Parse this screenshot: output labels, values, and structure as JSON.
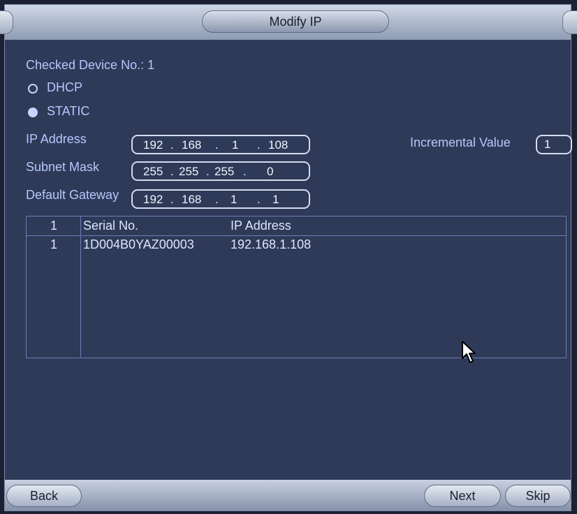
{
  "dialog": {
    "title": "Modify IP"
  },
  "device": {
    "checked_label": "Checked Device No.: 1"
  },
  "mode": {
    "dhcp_label": "DHCP",
    "static_label": "STATIC",
    "selected": "STATIC"
  },
  "ip_address": {
    "label": "IP Address",
    "octets": [
      "192",
      "168",
      "1",
      "108"
    ]
  },
  "subnet_mask": {
    "label": "Subnet Mask",
    "octets": [
      "255",
      "255",
      "255",
      "0"
    ]
  },
  "default_gateway": {
    "label": "Default Gateway",
    "octets": [
      "192",
      "168",
      "1",
      "1"
    ]
  },
  "incremental": {
    "label": "Incremental Value",
    "value": "1"
  },
  "table": {
    "headers": [
      "1",
      "Serial No.",
      "IP Address"
    ],
    "rows": [
      {
        "index": "1",
        "serial": "1D004B0YAZ00003",
        "ip": "192.168.1.108"
      }
    ]
  },
  "footer": {
    "back_label": "Back",
    "next_label": "Next",
    "skip_label": "Skip"
  },
  "colors": {
    "background": "#2e3a57",
    "label_text": "#b7c7ff",
    "value_text": "#f0f3ff",
    "grid_line": "#6d7db7"
  }
}
